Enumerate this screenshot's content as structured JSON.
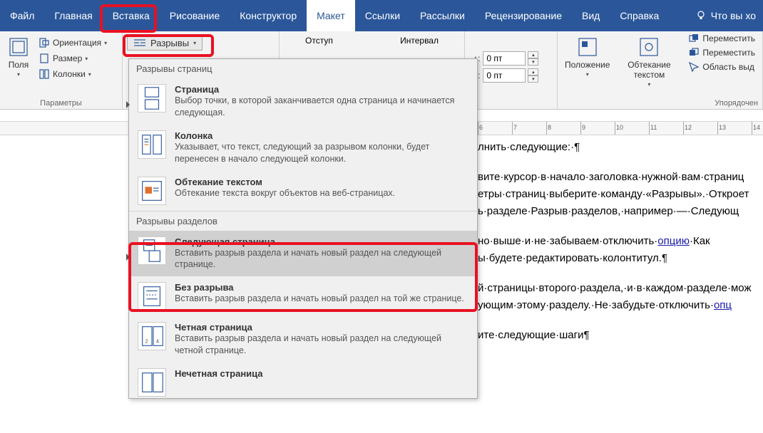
{
  "tabs": {
    "file": "Файл",
    "home": "Главная",
    "insert": "Вставка",
    "draw": "Рисование",
    "design": "Конструктор",
    "layout": "Макет",
    "references": "Ссылки",
    "mailings": "Рассылки",
    "review": "Рецензирование",
    "view": "Вид",
    "help": "Справка",
    "tell_me": "Что вы хо"
  },
  "page_setup": {
    "margins": "Поля",
    "orientation": "Ориентация",
    "size": "Размер",
    "columns": "Колонки",
    "breaks": "Разрывы",
    "group_label": "Параметры"
  },
  "paragraph": {
    "indent": "Отступ",
    "spacing": "Интервал",
    "before_label": ":",
    "before_value": "0 пт",
    "after_value": "0 пт"
  },
  "arrange": {
    "position": "Положение",
    "wrap": "Обтекание текстом",
    "bring": "Переместить",
    "send": "Переместить",
    "selection": "Область выд",
    "group_label": "Упорядочен"
  },
  "breaks_dd": {
    "page_header": "Разрывы страниц",
    "sec_header": "Разрывы разделов",
    "page": {
      "t": "Страница",
      "d": "Выбор точки, в которой заканчивается одна страница и начинается следующая."
    },
    "column": {
      "t": "Колонка",
      "d": "Указывает, что текст, следующий за разрывом колонки, будет перенесен в начало следующей колонки."
    },
    "wrap": {
      "t": "Обтекание текстом",
      "d": "Обтекание текста вокруг объектов на веб-страницах."
    },
    "next": {
      "t": "Следующая страница",
      "d": "Вставить разрыв раздела и начать новый раздел на следующей странице."
    },
    "cont": {
      "t": "Без разрыва",
      "d": "Вставить разрыв раздела и начать новый раздел на той же странице."
    },
    "even": {
      "t": "Четная страница",
      "d": "Вставить разрыв раздела и начать новый раздел на следующей четной странице."
    },
    "odd": {
      "t": "Нечетная страница"
    }
  },
  "doc": {
    "p1": "лнить·следующие:·¶",
    "p2": "вите·курсор·в·начало·заголовка·нужной·вам·страниц",
    "p3": "етры·страниц·выберите·команду·«Разрывы».·Откроет",
    "p4": "ь·разделе·Разрыв·разделов,·например·—·Следующ",
    "p5": "но·выше·и·не·забываем·отключить·",
    "p5_link": "опцию",
    "p5_tail": "·Как",
    "p6": "ы·будете·редактировать·колонтитул.¶",
    "p7": "й·страницы·второго·раздела,·и·в·каждом·разделе·мож",
    "p8": "ующим·этому·разделу.·Не·забудьте·отключить·",
    "p8_link": "опц",
    "p9": "ите·следующие·шаги¶"
  }
}
